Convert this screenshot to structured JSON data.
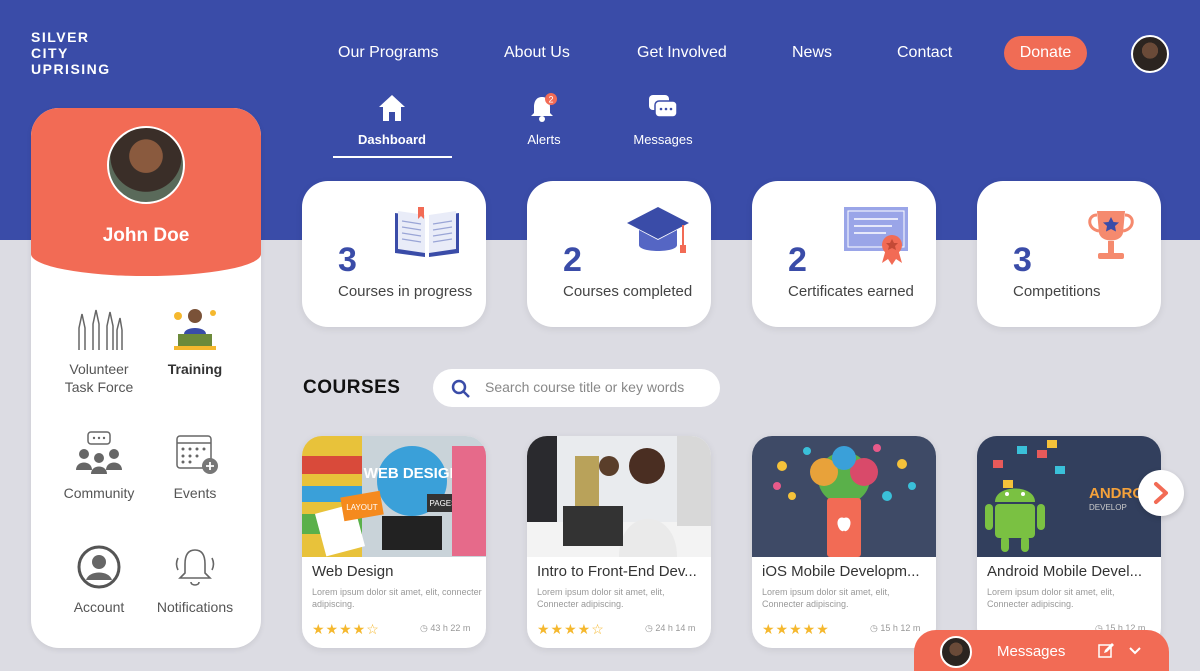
{
  "brand": {
    "logo_line1": "SILVER",
    "logo_line2": "CITY",
    "logo_line3": "UPRISING"
  },
  "nav": {
    "items": [
      "Our Programs",
      "About Us",
      "Get Involved",
      "News",
      "Contact"
    ],
    "donate_label": "Donate"
  },
  "subnav": {
    "dashboard": "Dashboard",
    "alerts": "Alerts",
    "alerts_badge": "2",
    "messages": "Messages"
  },
  "profile": {
    "name": "John Doe",
    "menu": {
      "volunteer_line1": "Volunteer",
      "volunteer_line2": "Task Force",
      "training": "Training",
      "community": "Community",
      "events": "Events",
      "account": "Account",
      "notifications": "Notifications"
    }
  },
  "stats": [
    {
      "number": "3",
      "label": "Courses in progress"
    },
    {
      "number": "2",
      "label": "Courses completed"
    },
    {
      "number": "2",
      "label": "Certificates earned"
    },
    {
      "number": "3",
      "label": "Competitions"
    }
  ],
  "courses": {
    "heading": "COURSES",
    "search_placeholder": "Search course title or key words",
    "cards": [
      {
        "title": "Web Design",
        "desc": "Lorem ipsum dolor sit amet, elit, connecter adipiscing.",
        "stars": "★★★★☆",
        "duration": "43 h 22 m",
        "img_text": "WEB DESIGN",
        "img_text2": "LAYOUT",
        "img_text3": "PAGES"
      },
      {
        "title": "Intro to Front-End Dev...",
        "desc": "Lorem ipsum dolor sit amet, elit, Connecter adipiscing.",
        "stars": "★★★★☆",
        "duration": "24 h 14 m"
      },
      {
        "title": "iOS Mobile Developm...",
        "desc": "Lorem ipsum dolor sit amet, elit, Connecter adipiscing.",
        "stars": "★★★★★",
        "duration": "15 h 12 m"
      },
      {
        "title": "Android Mobile Devel...",
        "desc": "Lorem ipsum dolor sit amet, elit, Connecter adipiscing.",
        "stars": "",
        "duration": "15 h 12 m",
        "img_text": "ANDROI",
        "img_text2": "DEVELOP"
      }
    ]
  },
  "messages_bar": {
    "label": "Messages"
  },
  "colors": {
    "primary": "#3a4ca8",
    "accent": "#f26b55",
    "star": "#f5b82e"
  }
}
